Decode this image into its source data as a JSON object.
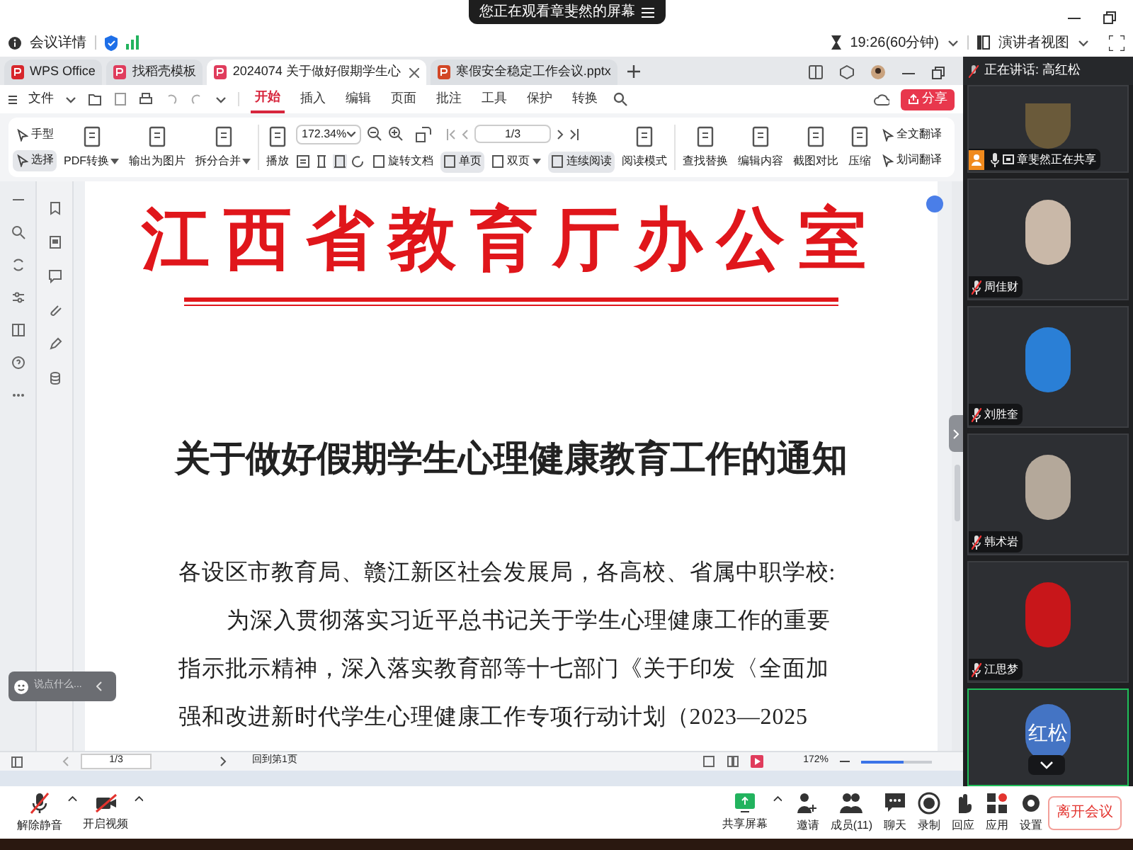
{
  "meeting_bar": {
    "banner": "您正在观看章斐然的屏幕",
    "details": "会议详情",
    "timer": "19:26(60分钟)",
    "view": "演讲者视图"
  },
  "wps_tabs": [
    {
      "label": "WPS Office",
      "selected": false
    },
    {
      "label": "找稻壳模板",
      "selected": false
    },
    {
      "label": "2024074 关于做好假期学生心",
      "selected": true
    },
    {
      "label": "寒假安全稳定工作会议.pptx",
      "selected": false
    }
  ],
  "menu": {
    "file": "文件",
    "tabs": [
      {
        "label": "开始",
        "selected": true
      },
      {
        "label": "插入",
        "selected": false
      },
      {
        "label": "编辑",
        "selected": false
      },
      {
        "label": "页面",
        "selected": false
      },
      {
        "label": "批注",
        "selected": false
      },
      {
        "label": "工具",
        "selected": false
      },
      {
        "label": "保护",
        "selected": false
      },
      {
        "label": "转换",
        "selected": false
      }
    ],
    "share": "分享"
  },
  "ribbon": [
    {
      "kind": "stack",
      "items": [
        {
          "label": "手型",
          "selected": false
        },
        {
          "label": "选择",
          "selected": true
        }
      ]
    },
    {
      "kind": "large",
      "label": "PDF转换",
      "dropdown": true
    },
    {
      "kind": "large",
      "label": "输出为图片",
      "dropdown": false
    },
    {
      "kind": "large",
      "label": "拆分合并",
      "dropdown": true
    },
    {
      "kind": "large",
      "label": "播放",
      "dropdown": false
    },
    {
      "kind": "view",
      "zoom": "172.34%",
      "page": "1/3",
      "buttons": [
        {
          "label": "旋转文档",
          "selected": false,
          "dropdown": false
        },
        {
          "label": "单页",
          "selected": true,
          "dropdown": false
        },
        {
          "label": "双页",
          "selected": false,
          "dropdown": true
        },
        {
          "label": "连续阅读",
          "selected": true,
          "dropdown": false
        }
      ]
    },
    {
      "kind": "large",
      "label": "阅读模式",
      "dropdown": false
    },
    {
      "kind": "large",
      "label": "查找替换",
      "dropdown": false
    },
    {
      "kind": "large",
      "label": "编辑内容",
      "dropdown": false
    },
    {
      "kind": "large",
      "label": "截图对比",
      "dropdown": false
    },
    {
      "kind": "large",
      "label": "压缩",
      "dropdown": false
    },
    {
      "kind": "stack",
      "items": [
        {
          "label": "全文翻译",
          "selected": false
        },
        {
          "label": "划词翻译",
          "selected": false
        }
      ]
    }
  ],
  "document": {
    "office": "江西省教育厅办公室",
    "title": "关于做好假期学生心理健康教育工作的通知",
    "paragraphs": [
      {
        "kind": "salutation",
        "lines": [
          "各设区市教育局、赣江新区社会发展局，各高校、省属中职学校:"
        ]
      },
      {
        "kind": "body",
        "lines": [
          "为深入贯彻落实习近平总书记关于学生心理健康工作的重要",
          "指示批示精神，深入落实教育部等十七部门《关于印发〈全面加",
          "强和改进新时代学生心理健康工作专项行动计划（2023—2025"
        ]
      }
    ]
  },
  "chat_input": {
    "placeholder": "说点什么..."
  },
  "status_bar": {
    "page": "1/3",
    "back": "回到第1页",
    "zoom": "172%",
    "zoom_slider": {
      "level": 0.6
    }
  },
  "speaker": {
    "label": "正在讲话: 高红松"
  },
  "participants": [
    {
      "name": "章斐然正在共享",
      "kind": "sharer",
      "muted": false,
      "speaking": false
    },
    {
      "name": "周佳财",
      "kind": "photo",
      "muted": true,
      "speaking": false
    },
    {
      "name": "刘胜奎",
      "kind": "photo",
      "muted": true,
      "speaking": false
    },
    {
      "name": "韩术岩",
      "kind": "photo",
      "muted": true,
      "speaking": false
    },
    {
      "name": "江思梦",
      "kind": "photo",
      "muted": true,
      "speaking": false
    },
    {
      "initials": "红松",
      "kind": "initials",
      "speaking": true
    }
  ],
  "toolbar": {
    "mic": {
      "label": "解除静音",
      "muted": true
    },
    "video": {
      "label": "开启视频",
      "off": true
    },
    "center": [
      {
        "label": "共享屏幕",
        "kind": "share"
      },
      {
        "label": "邀请",
        "kind": "plain"
      },
      {
        "label": "成员(11)",
        "kind": "plain"
      },
      {
        "label": "聊天",
        "kind": "plain"
      },
      {
        "label": "录制",
        "kind": "plain"
      },
      {
        "label": "回应",
        "kind": "plain"
      },
      {
        "label": "应用",
        "kind": "plain"
      },
      {
        "label": "设置",
        "kind": "plain"
      }
    ],
    "leave": "离开会议"
  }
}
